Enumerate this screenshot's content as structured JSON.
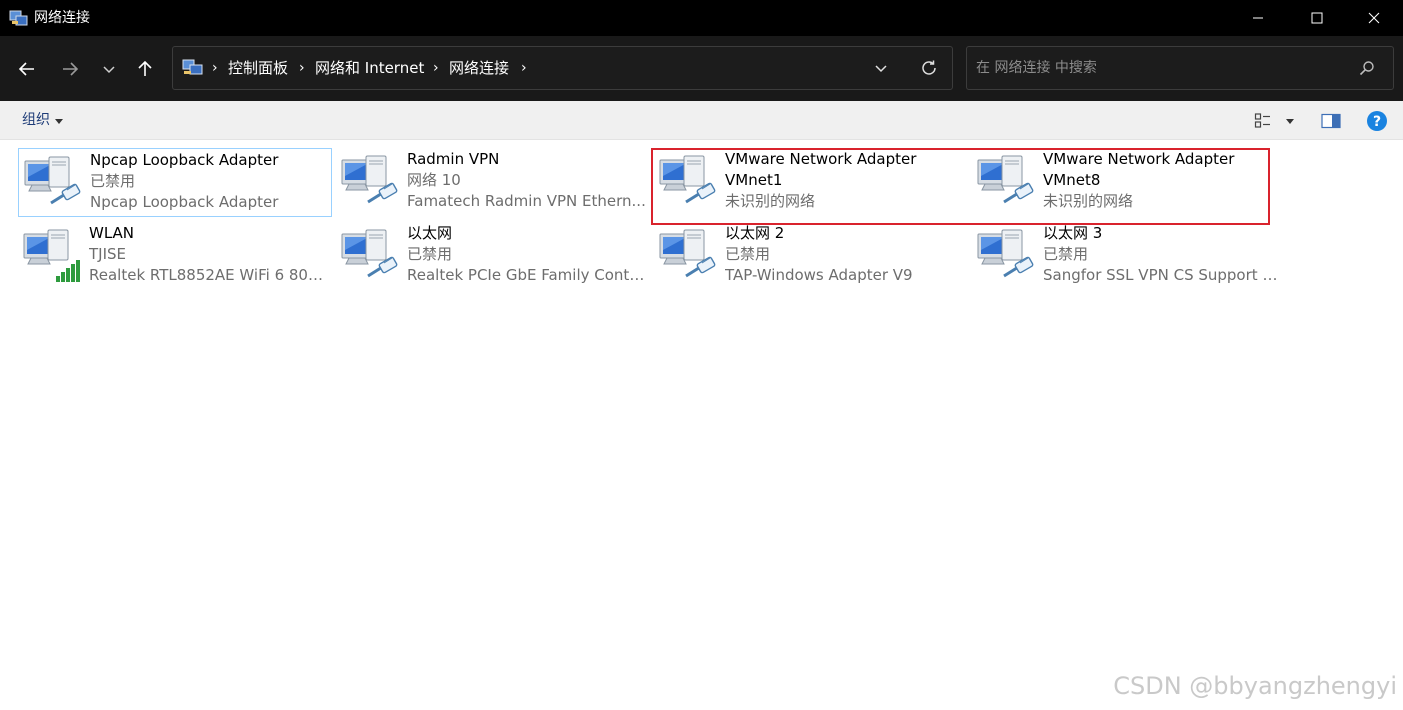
{
  "window": {
    "title": "网络连接",
    "minimize_icon": "minimize-icon",
    "maximize_icon": "maximize-icon",
    "close_icon": "close-icon"
  },
  "nav": {
    "breadcrumbs": [
      "控制面板",
      "网络和 Internet",
      "网络连接"
    ],
    "search_placeholder": "在 网络连接 中搜索"
  },
  "toolbar": {
    "organize_label": "组织"
  },
  "adapters": [
    {
      "name": "Npcap Loopback Adapter",
      "status": "已禁用",
      "device": "Npcap Loopback Adapter",
      "selected": true,
      "badge": "cable"
    },
    {
      "name": "Radmin VPN",
      "status": "网络 10",
      "device": "Famatech Radmin VPN Ethern...",
      "selected": false,
      "badge": "cable"
    },
    {
      "name": "VMware Network Adapter",
      "status": "VMnet1",
      "device": "未识别的网络",
      "selected": false,
      "badge": "cable"
    },
    {
      "name": "VMware Network Adapter",
      "status": "VMnet8",
      "device": "未识别的网络",
      "selected": false,
      "badge": "cable"
    },
    {
      "name": "WLAN",
      "status": "TJISE",
      "device": "Realtek RTL8852AE WiFi 6 802....",
      "selected": false,
      "badge": "wifi"
    },
    {
      "name": "以太网",
      "status": "已禁用",
      "device": "Realtek PCIe GbE Family Contr...",
      "selected": false,
      "badge": "cable"
    },
    {
      "name": "以太网 2",
      "status": "已禁用",
      "device": "TAP-Windows Adapter V9",
      "selected": false,
      "badge": "cable"
    },
    {
      "name": "以太网 3",
      "status": "已禁用",
      "device": "Sangfor SSL VPN CS Support S...",
      "selected": false,
      "badge": "cable"
    }
  ],
  "watermark": "CSDN @bbyangzhengyi",
  "colors": {
    "highlight": "#d9232d",
    "selection": "#99d1ff",
    "link": "#1e3c78"
  }
}
